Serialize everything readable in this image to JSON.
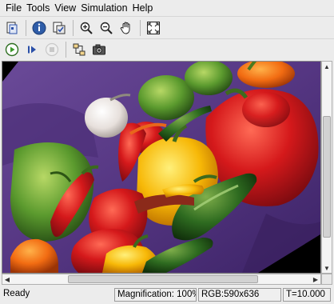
{
  "menu": [
    "File",
    "Tools",
    "View",
    "Simulation",
    "Help"
  ],
  "toolbar1": {
    "buttons": [
      "new-model-icon",
      "info-icon",
      "properties-icon",
      "zoom-in-icon",
      "zoom-out-icon",
      "pan-hand-icon",
      "fit-to-view-icon"
    ]
  },
  "toolbar2": {
    "buttons": [
      "run-icon",
      "step-forward-icon",
      "stop-icon",
      "model-explorer-icon",
      "snapshot-camera-icon"
    ],
    "colors": {
      "run": "#3c9a2a",
      "stop_disabled": "#c8c8c8"
    }
  },
  "viewport": {
    "image_subject": "peppers photo (rotated)",
    "colors": {
      "background": "#000000",
      "cloth": "#5a3a86"
    }
  },
  "status": {
    "ready": "Ready",
    "magnification": "Magnification: 100%",
    "rgb": "RGB:590x636",
    "time": "T=10.000"
  }
}
